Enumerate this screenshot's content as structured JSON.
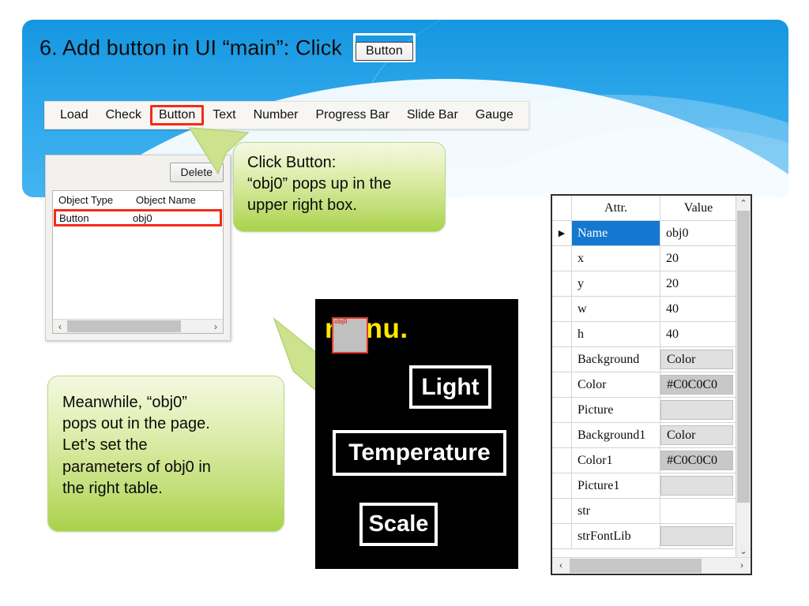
{
  "slide": {
    "title": "6. Add button in UI “main”: Click",
    "title_button_label": "Button"
  },
  "toolbar": {
    "items": [
      {
        "label": "Load",
        "selected": false
      },
      {
        "label": "Check",
        "selected": false
      },
      {
        "label": "Button",
        "selected": true
      },
      {
        "label": "Text",
        "selected": false
      },
      {
        "label": "Number",
        "selected": false
      },
      {
        "label": "Progress Bar",
        "selected": false
      },
      {
        "label": "Slide Bar",
        "selected": false
      },
      {
        "label": "Gauge",
        "selected": false
      }
    ]
  },
  "object_window": {
    "delete_label": "Delete",
    "columns": [
      "Object Type",
      "Object Name"
    ],
    "rows": [
      {
        "type": "Button",
        "name": "obj0",
        "highlighted": true
      }
    ],
    "scroll_left_icon": "‹",
    "scroll_right_icon": "›"
  },
  "callouts": {
    "top": {
      "line1": "Click Button:",
      "line2": "“obj0” pops up in the",
      "line3": "upper right box."
    },
    "bottom": {
      "line1": "Meanwhile, “obj0”",
      "line2": "pops out in the page.",
      "line3": "Let’s set the",
      "line4": "parameters of obj0 in",
      "line5": "the right table."
    }
  },
  "preview": {
    "menu_text": "menu.",
    "obj_tag": "obj0",
    "buttons": [
      {
        "label": "Light"
      },
      {
        "label": "Temperature"
      },
      {
        "label": "Scale"
      }
    ]
  },
  "property_grid": {
    "header": {
      "attr": "Attr.",
      "value": "Value"
    },
    "selected_marker": "▶",
    "rows": [
      {
        "attr": "Name",
        "value": "obj0",
        "selected": true,
        "shade": "none"
      },
      {
        "attr": "x",
        "value": "20",
        "selected": false,
        "shade": "none"
      },
      {
        "attr": "y",
        "value": "20",
        "selected": false,
        "shade": "none"
      },
      {
        "attr": "w",
        "value": "40",
        "selected": false,
        "shade": "none"
      },
      {
        "attr": "h",
        "value": "40",
        "selected": false,
        "shade": "none"
      },
      {
        "attr": "Background",
        "value": "Color",
        "selected": false,
        "shade": "light"
      },
      {
        "attr": "Color",
        "value": "#C0C0C0",
        "selected": false,
        "shade": "dark"
      },
      {
        "attr": "Picture",
        "value": "",
        "selected": false,
        "shade": "light"
      },
      {
        "attr": "Background1",
        "value": "Color",
        "selected": false,
        "shade": "light"
      },
      {
        "attr": "Color1",
        "value": "#C0C0C0",
        "selected": false,
        "shade": "dark"
      },
      {
        "attr": "Picture1",
        "value": "",
        "selected": false,
        "shade": "light"
      },
      {
        "attr": "str",
        "value": "",
        "selected": false,
        "shade": "none"
      },
      {
        "attr": "strFontLib",
        "value": "",
        "selected": false,
        "shade": "light"
      }
    ],
    "scroll_up_icon": "⌃",
    "scroll_down_icon": "⌄",
    "scroll_left_icon": "‹",
    "scroll_right_icon": "›"
  },
  "colors": {
    "banner_blue": "#2ca6ea",
    "highlight_red": "#f42b19",
    "callout_green": "#a9d24a",
    "selection_blue": "#1478d0",
    "object_gray": "#C0C0C0",
    "menu_yellow": "#ffe800"
  }
}
